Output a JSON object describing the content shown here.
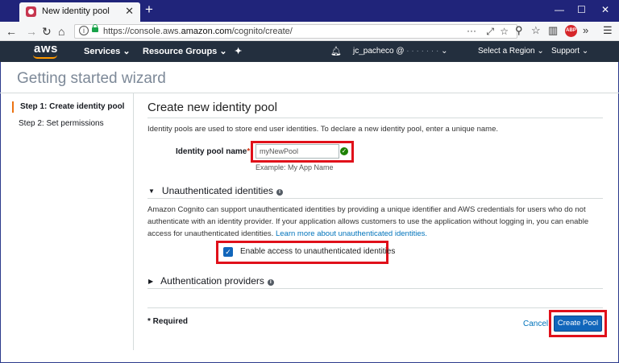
{
  "browser": {
    "tab_title": "New identity pool",
    "tab_close": "✕",
    "new_tab": "+",
    "window_controls": [
      "—",
      "☐",
      "✕"
    ],
    "url_prefix": "https://console.aws.",
    "url_domain": "amazon.com",
    "url_path": "/cognito/create/",
    "url_dots": "···",
    "menu": "☰",
    "overflow": "»"
  },
  "aws_nav": {
    "logo": "aws",
    "services": "Services",
    "resource_groups": "Resource Groups",
    "user": "jc_pacheco @",
    "region": "Select a Region",
    "support": "Support",
    "caret": "⌄"
  },
  "wizard": {
    "title": "Getting started wizard",
    "steps": [
      "Step 1: Create identity pool",
      "Step 2: Set permissions"
    ]
  },
  "form": {
    "heading": "Create new identity pool",
    "intro": "Identity pools are used to store end user identities. To declare a new identity pool, enter a unique name.",
    "pool_name_label": "Identity pool name",
    "required_mark": "*",
    "pool_name_value": "myNewPool",
    "pool_name_hint": "Example: My App Name",
    "unauth_section": "Unauthenticated identities",
    "unauth_description": "Amazon Cognito can support unauthenticated identities by providing a unique identifier and AWS credentials for users who do not authenticate with an identity provider. If your application allows customers to use the application without logging in, you can enable access for unauthenticated identities.",
    "unauth_link": "Learn more about unauthenticated identities.",
    "enable_unauth_label": "Enable access to unauthenticated identities",
    "enable_unauth_checked": true,
    "auth_providers_section": "Authentication providers",
    "required_note": "* Required",
    "cancel": "Cancel",
    "create": "Create Pool"
  },
  "colors": {
    "aws_bar": "#232f3e",
    "accent_orange": "#ff9900",
    "primary_button": "#1166bb",
    "highlight_red": "#e0101a",
    "browser_frame": "#20247a"
  }
}
